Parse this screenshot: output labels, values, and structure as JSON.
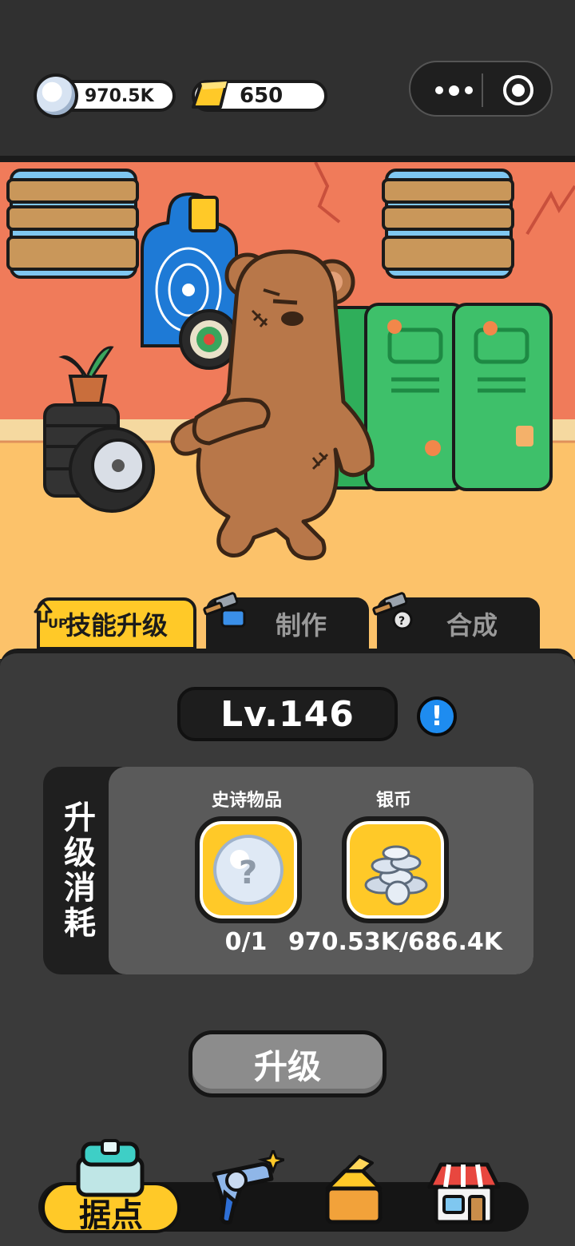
{
  "resources": {
    "silver": {
      "value": "970.5K",
      "icon": "silver-coin-icon"
    },
    "gold": {
      "value": "650",
      "icon": "gold-bar-icon"
    }
  },
  "mini_program_menu": {
    "more_icon": "more-dots-icon",
    "close_icon": "target-close-icon"
  },
  "tabs": [
    {
      "label": "技能升级",
      "active": true,
      "icon": "up-arrow-icon"
    },
    {
      "label": "制作",
      "active": false,
      "icon": "hammer-icon"
    },
    {
      "label": "合成",
      "active": false,
      "icon": "anvil-icon"
    }
  ],
  "panel": {
    "level": "Lv.146",
    "cost_title": "升级消耗",
    "items": [
      {
        "label": "史诗物品",
        "count": "0/1",
        "icon": "unknown-epic-item-icon"
      },
      {
        "label": "银币",
        "count": "970.53K/686.4K",
        "icon": "silver-coins-pile-icon"
      }
    ],
    "upgrade_label": "升级"
  },
  "bottom_nav": [
    {
      "label": "据点",
      "active": true,
      "icon": "base-chest-icon"
    },
    {
      "label": "",
      "active": false,
      "icon": "revolver-icon"
    },
    {
      "label": "",
      "active": false,
      "icon": "supply-box-icon"
    },
    {
      "label": "",
      "active": false,
      "icon": "shop-icon"
    }
  ],
  "colors": {
    "accent": "#ffc928",
    "panel": "#3a3a3a",
    "info": "#1e8cf0"
  }
}
